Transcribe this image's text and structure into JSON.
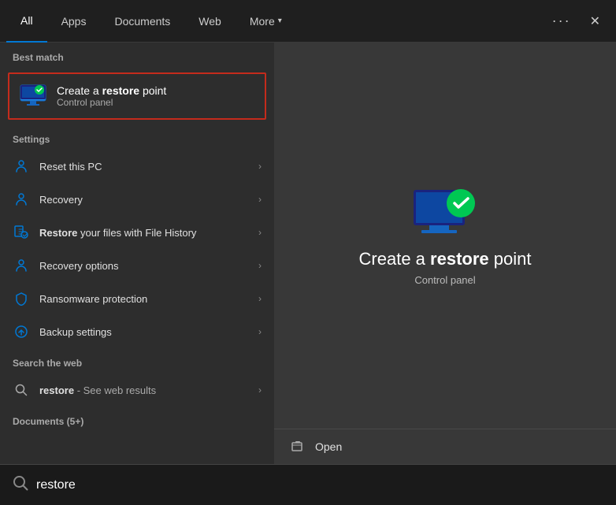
{
  "nav": {
    "tabs": [
      {
        "id": "all",
        "label": "All",
        "active": true
      },
      {
        "id": "apps",
        "label": "Apps"
      },
      {
        "id": "documents",
        "label": "Documents"
      },
      {
        "id": "web",
        "label": "Web"
      },
      {
        "id": "more",
        "label": "More",
        "hasArrow": true
      }
    ],
    "dots_label": "···",
    "close_label": "✕"
  },
  "left": {
    "best_match_label": "Best match",
    "best_match": {
      "title_prefix": "Create a ",
      "title_bold": "restore",
      "title_suffix": " point",
      "subtitle": "Control panel"
    },
    "settings_label": "Settings",
    "settings_items": [
      {
        "id": "reset",
        "icon": "👤",
        "label_plain": "Reset this PC",
        "label_bold": ""
      },
      {
        "id": "recovery",
        "icon": "🔄",
        "label_plain": "Recovery",
        "label_bold": ""
      },
      {
        "id": "restore_files",
        "icon": "🔄",
        "label_prefix": "",
        "label_bold": "Restore",
        "label_suffix": " your files with File History"
      },
      {
        "id": "recovery_options",
        "icon": "👤",
        "label_plain": "Recovery options",
        "label_bold": ""
      },
      {
        "id": "ransomware",
        "icon": "🛡",
        "label_plain": "Ransomware protection",
        "label_bold": ""
      },
      {
        "id": "backup",
        "icon": "⬆",
        "label_plain": "Backup settings",
        "label_bold": ""
      }
    ],
    "web_section_label": "Search the web",
    "web_item": {
      "keyword": "restore",
      "suffix": " - See web results"
    },
    "documents_label": "Documents (5+)"
  },
  "right": {
    "title_prefix": "Create a ",
    "title_bold": "restore",
    "title_suffix": " point",
    "subtitle": "Control panel",
    "actions": [
      {
        "id": "open",
        "label": "Open"
      }
    ]
  },
  "search": {
    "placeholder": "restore",
    "value": "restore"
  }
}
